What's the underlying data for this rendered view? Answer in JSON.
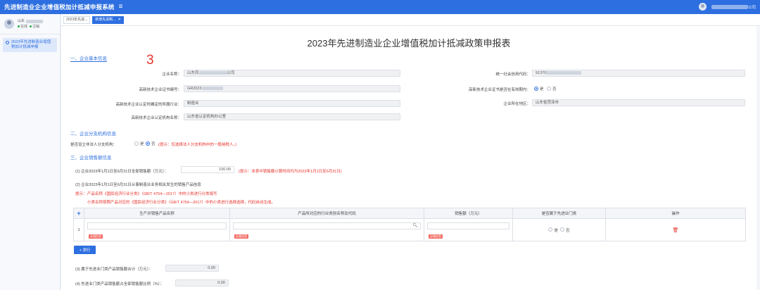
{
  "header": {
    "title": "先进制造业企业增值税加计抵减申报系统",
    "menu_icon": "menu-icon",
    "user_suffix": "公司"
  },
  "sidebar": {
    "profile_name": "山东",
    "status_online": "在线",
    "status_exit": "注销",
    "nav_item": "2023年先进制造业增值税加计抵减申报"
  },
  "tabs": [
    {
      "label": "2023年先进..."
    },
    {
      "label": "新增先进制..."
    }
  ],
  "page": {
    "title": "2023年先进制造业企业增值税加计抵减政策申报表",
    "mark": "3"
  },
  "s1": {
    "title": "一、企业基本信息",
    "company_name_label": "企业名称：",
    "company_name_prefix": "山东凤",
    "company_name_suffix": "公司",
    "credit_code_label": "统一社会信用代码：",
    "credit_code_prefix": "91370",
    "hitech_no_label": "高新技术企业证书编号：",
    "hitech_no_prefix": "GR2023",
    "cert_valid_label": "高新技术企业证书是否在有效期内：",
    "cert_yes": "是",
    "cert_no": "否",
    "industry_label": "高新技术企业认定时确定的所属行业：",
    "industry_value": "制造业",
    "region_label": "企业所在地区：",
    "region_value": "山东省菏泽市",
    "office_label": "高新技术企业认定机构名称：",
    "office_value": "山东省认定机构办公室"
  },
  "s2": {
    "title": "二、企业分支机构信息",
    "question": "是否设立非法人分支机构：",
    "yes": "是",
    "no": "否",
    "hint": "(提示：仅选择法人分支机构中的一般纳税人。)"
  },
  "s3": {
    "title": "三、企业销售额信息",
    "q1_label": "(1) 企业2023年1月1日至6月31日全部销售额（万元）：",
    "q1_value": "100.00",
    "q1_hint": "(提示：本表中销售额计算时间均为2023年1月1日至6月31日)",
    "q2_label": "(2) 企业2023年1月1日至6月31日从事制造业业务相关发生的销售产品信息",
    "tip_title": "提示：",
    "tip_line1": "产品名称《国民经济行业分类》（GB/T 4754—2017）中的小类进行分类填写",
    "tip_line2": "小类名称按照产品对应的《国民经济行业分类》（GB/T 4754—2017）中的小类进行选择选择，代码自动生成。",
    "columns": [
      "+",
      "生产并销售产品名称",
      "产品所对应的行业类别名称及代码",
      "销售额（万元）",
      "是否属于先进业门类",
      "操作"
    ],
    "row": {
      "index": "1",
      "required": "必填信息",
      "radio_yes": "是",
      "radio_no": "否"
    },
    "add_button": "+ 添行",
    "q3_label": "(3) 属于先进业门类产品销售额合计（万元）：",
    "q3_value": "0.00",
    "q4_label": "(4) 先进业门类产品销售额占全部销售额比例（%）：",
    "q4_value": "0.00"
  }
}
